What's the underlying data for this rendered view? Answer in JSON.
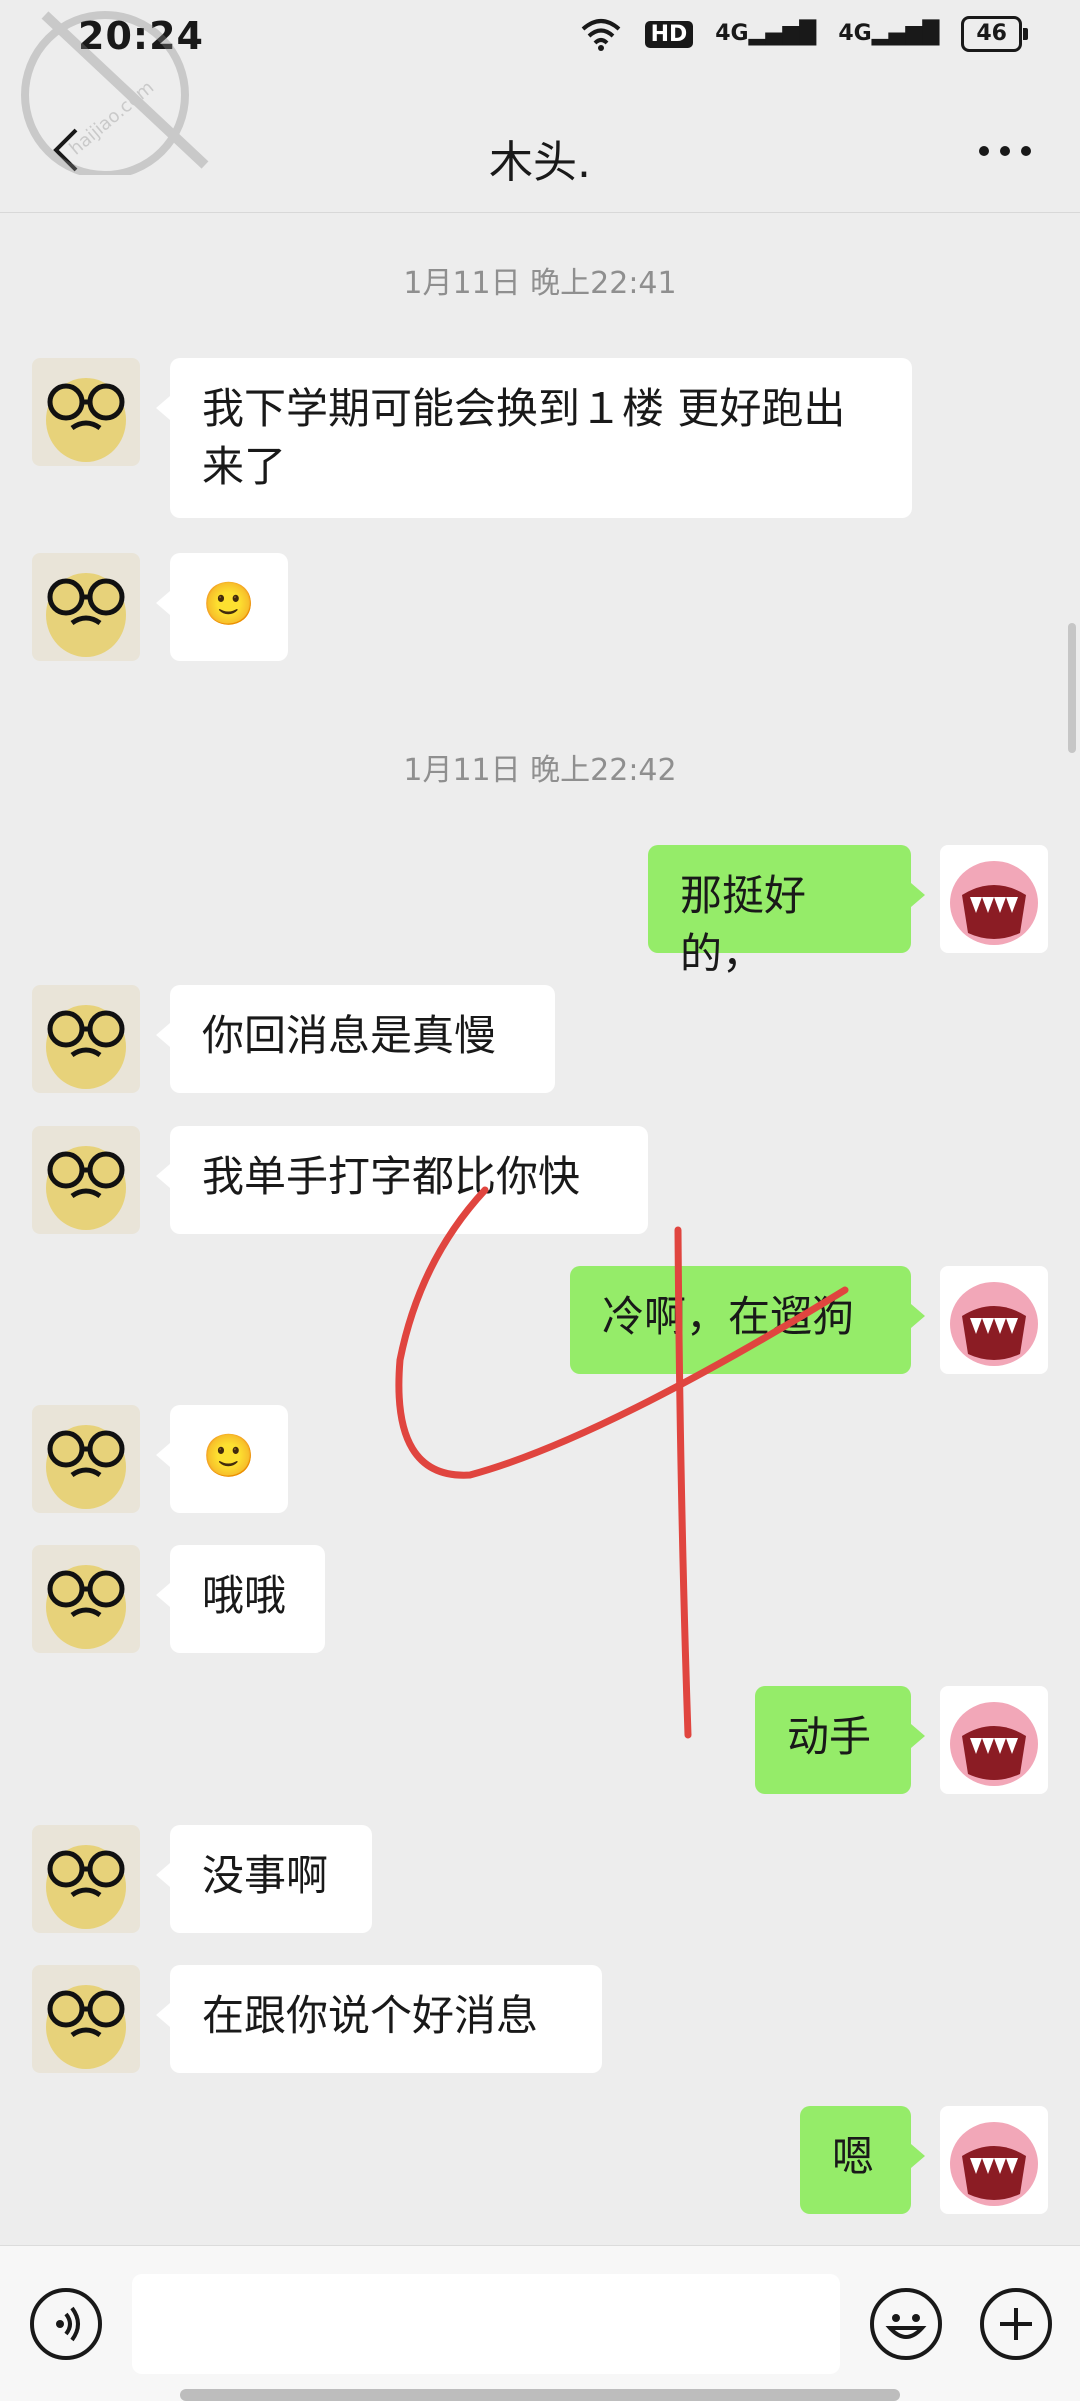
{
  "status_bar": {
    "time": "20:24",
    "hd": "HD",
    "signal1": "4G",
    "signal2": "4G",
    "battery": "46"
  },
  "header": {
    "title": "木头."
  },
  "watermark": {
    "text": "haijiao.com"
  },
  "messages": {
    "ts1": "1月11日 晚上22:41",
    "m1": "我下学期可能会换到１楼 更好跑出来了",
    "m2": "🙂",
    "ts2": "1月11日 晚上22:42",
    "m3": "那挺好的，",
    "m4": "你回消息是真慢",
    "m5": "我单手打字都比你快",
    "m6": "冷啊，在遛狗",
    "m7": "🙂",
    "m8": "哦哦",
    "m9": "动手",
    "m10": "没事啊",
    "m11": "在跟你说个好消息",
    "m12": "嗯"
  },
  "colors": {
    "background": "#ededed",
    "outgoing_bubble": "#95ec69",
    "incoming_bubble": "#ffffff",
    "scribble": "#e0453f"
  }
}
